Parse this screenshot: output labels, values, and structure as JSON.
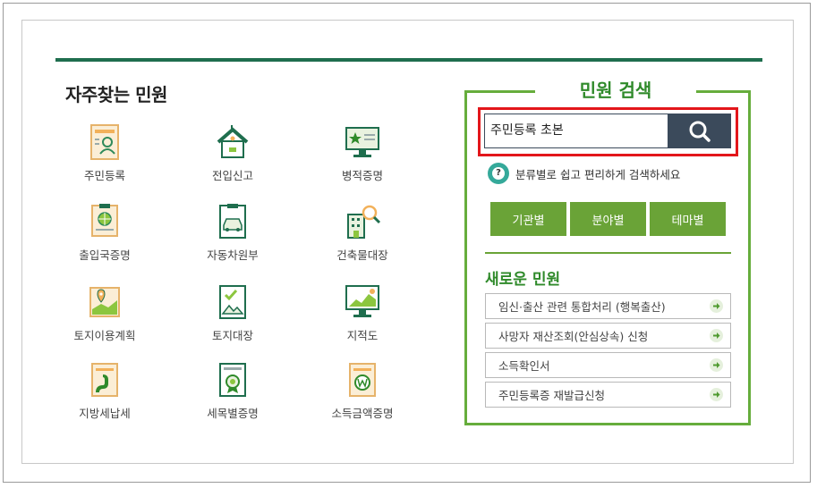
{
  "frequent": {
    "title": "자주찾는 민원",
    "items": [
      {
        "label": "주민등록",
        "icon": "resident-registration-icon"
      },
      {
        "label": "전입신고",
        "icon": "house-icon"
      },
      {
        "label": "병적증명",
        "icon": "monitor-star-icon"
      },
      {
        "label": "출입국증명",
        "icon": "globe-certificate-icon"
      },
      {
        "label": "자동차원부",
        "icon": "car-document-icon"
      },
      {
        "label": "건축물대장",
        "icon": "building-search-icon"
      },
      {
        "label": "토지이용계획",
        "icon": "land-map-icon"
      },
      {
        "label": "토지대장",
        "icon": "land-document-icon"
      },
      {
        "label": "지적도",
        "icon": "map-monitor-icon"
      },
      {
        "label": "지방세납세",
        "icon": "tax-document-icon"
      },
      {
        "label": "세목별증명",
        "icon": "certificate-medal-icon"
      },
      {
        "label": "소득금액증명",
        "icon": "won-document-icon"
      }
    ]
  },
  "search": {
    "title": "민원 검색",
    "value": "주민등록 초본",
    "help_text": "분류별로 쉽고 편리하게 검색하세요",
    "help_icon_text": "?",
    "categories": [
      "기관별",
      "분야별",
      "테마별"
    ]
  },
  "new_services": {
    "title": "새로운 민원",
    "items": [
      "임신·출산 관련 통합처리 (행복출산)",
      "사망자 재산조회(안심상속) 신청",
      "소득확인서",
      "주민등록증 재발급신청"
    ]
  },
  "colors": {
    "dark_green": "#1f6e4e",
    "green": "#6aa337",
    "highlight_red": "#e3161b",
    "search_button": "#3b4a5b"
  }
}
